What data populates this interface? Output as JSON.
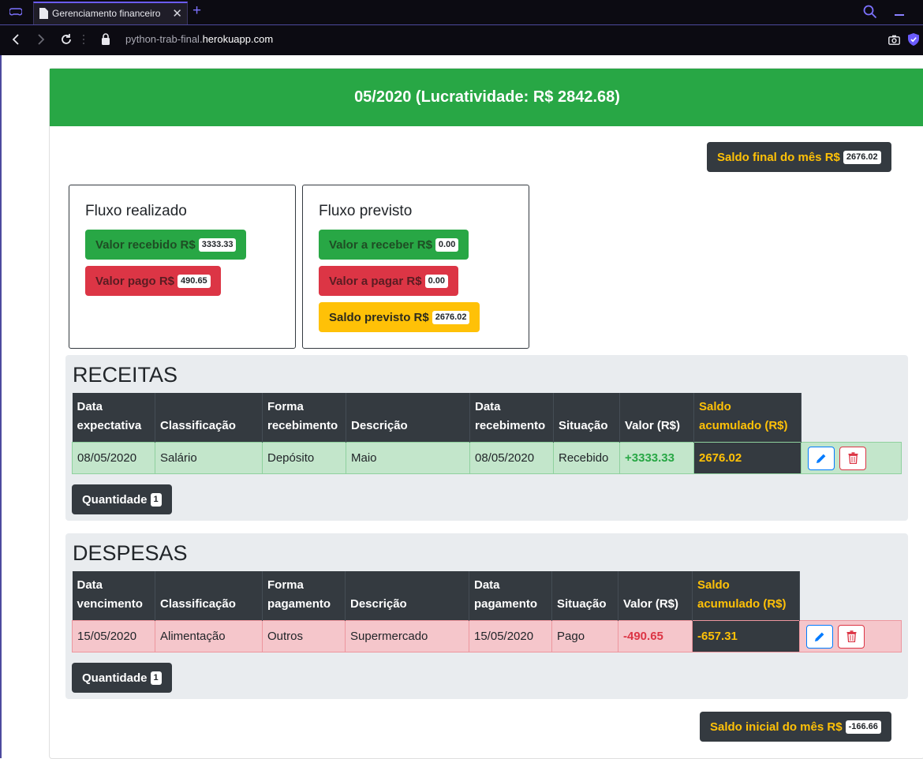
{
  "browser": {
    "tab_title": "Gerenciamento financeiro",
    "tab_close": "✕",
    "new_tab": "+",
    "url_prefix": "python-trab-final.",
    "url_host": "herokuapp.com"
  },
  "page": {
    "header": "05/2020 (Lucratividade: R$ 2842.68)",
    "saldo_final_label": "Saldo final do mês R$",
    "saldo_final_value": "2676.02",
    "saldo_inicial_label": "Saldo inicial do mês R$",
    "saldo_inicial_value": "-166.66"
  },
  "fluxo_realizado": {
    "title": "Fluxo realizado",
    "recebido_label": "Valor recebido R$",
    "recebido_value": "3333.33",
    "pago_label": "Valor pago R$",
    "pago_value": "490.65"
  },
  "fluxo_previsto": {
    "title": "Fluxo previsto",
    "receber_label": "Valor a receber R$",
    "receber_value": "0.00",
    "pagar_label": "Valor a pagar R$",
    "pagar_value": "0.00",
    "saldo_label": "Saldo previsto R$",
    "saldo_value": "2676.02"
  },
  "receitas": {
    "title": "RECEITAS",
    "headers": {
      "data_exp": [
        "Data",
        "expectativa"
      ],
      "classificacao": "Classificação",
      "forma": [
        "Forma",
        "recebimento"
      ],
      "descricao": "Descrição",
      "data_rec": [
        "Data",
        "recebimento"
      ],
      "situacao": "Situação",
      "valor": "Valor (R$)",
      "saldo": [
        "Saldo",
        "acumulado (R$)"
      ]
    },
    "row": {
      "data_exp": "08/05/2020",
      "classificacao": "Salário",
      "forma": "Depósito",
      "descricao": "Maio",
      "data_rec": "08/05/2020",
      "situacao": "Recebido",
      "valor": "+3333.33",
      "saldo": "2676.02"
    },
    "quantidade_label": "Quantidade",
    "quantidade_value": "1"
  },
  "despesas": {
    "title": "DESPESAS",
    "headers": {
      "data_venc": [
        "Data",
        "vencimento"
      ],
      "classificacao": "Classificação",
      "forma": [
        "Forma",
        "pagamento"
      ],
      "descricao": "Descrição",
      "data_pag": [
        "Data",
        "pagamento"
      ],
      "situacao": "Situação",
      "valor": "Valor (R$)",
      "saldo": [
        "Saldo",
        "acumulado (R$)"
      ]
    },
    "row": {
      "data_venc": "15/05/2020",
      "classificacao": "Alimentação",
      "forma": "Outros",
      "descricao": "Supermercado",
      "data_pag": "15/05/2020",
      "situacao": "Pago",
      "valor": "-490.65",
      "saldo": "-657.31"
    },
    "quantidade_label": "Quantidade",
    "quantidade_value": "1"
  },
  "colors": {
    "success": "#28a745",
    "danger": "#dc3545",
    "warning": "#ffc107",
    "dark": "#343a40",
    "primary": "#007bff"
  }
}
